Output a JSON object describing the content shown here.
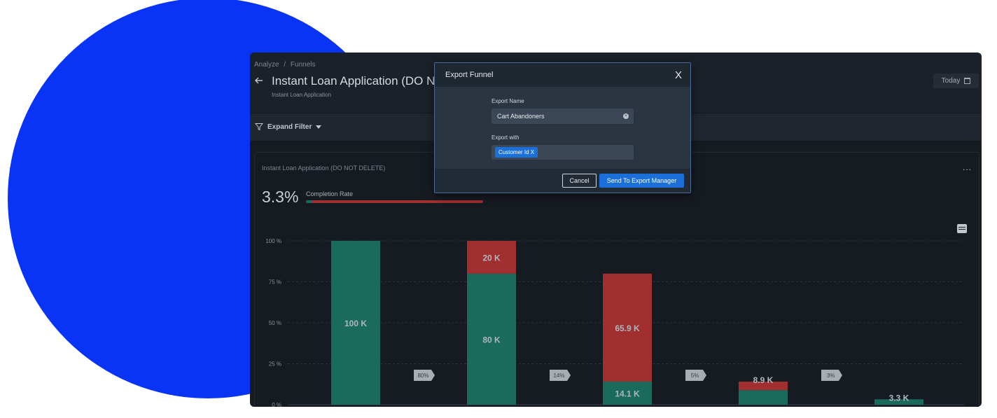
{
  "breadcrumb": [
    "Analyze",
    "/",
    "Funnels"
  ],
  "page": {
    "title": "Instant Loan Application (DO NO",
    "subtitle": "Instant Loan Application"
  },
  "header": {
    "today_label": "Today"
  },
  "filter": {
    "label": "Expand Filter"
  },
  "card": {
    "title": "Instant Loan Application (DO NOT DELETE)",
    "menu": "...",
    "completion_value": "3.3%",
    "completion_label": "Completion Rate",
    "completion_fraction": 0.033
  },
  "modal": {
    "title": "Export Funnel",
    "close": "X",
    "name_label": "Export Name",
    "name_value": "Cart Abandoners",
    "with_label": "Export with",
    "tag": "Customer Id X",
    "cancel": "Cancel",
    "send": "Send To Export Manager"
  },
  "colors": {
    "converted": "#1b6b5c",
    "dropped": "#a22f2f",
    "accent": "#1a6fd8",
    "circle": "#0a34f5"
  },
  "chart_data": {
    "type": "bar",
    "stacked": true,
    "ylim": [
      0,
      100
    ],
    "y_ticks": [
      0,
      25,
      50,
      75,
      100
    ],
    "y_tick_labels": [
      "0 %",
      "25 %",
      "50 %",
      "75 %",
      "100 %"
    ],
    "series": [
      {
        "name": "",
        "values_pct": [
          100,
          80,
          14.1,
          8.9,
          3.3
        ],
        "labels": [
          "100 K",
          "80 K",
          "14.1 K",
          "",
          "3.3 K"
        ],
        "color": "#1b6b5c"
      },
      {
        "name": "",
        "values_pct": [
          0,
          20,
          65.9,
          5.2,
          0
        ],
        "labels": [
          "",
          "20 K",
          "65.9 K",
          "8.9 K",
          ""
        ],
        "color": "#a22f2f"
      }
    ],
    "conversion_tags": [
      "80%",
      "14%",
      "5%",
      "3%"
    ]
  }
}
